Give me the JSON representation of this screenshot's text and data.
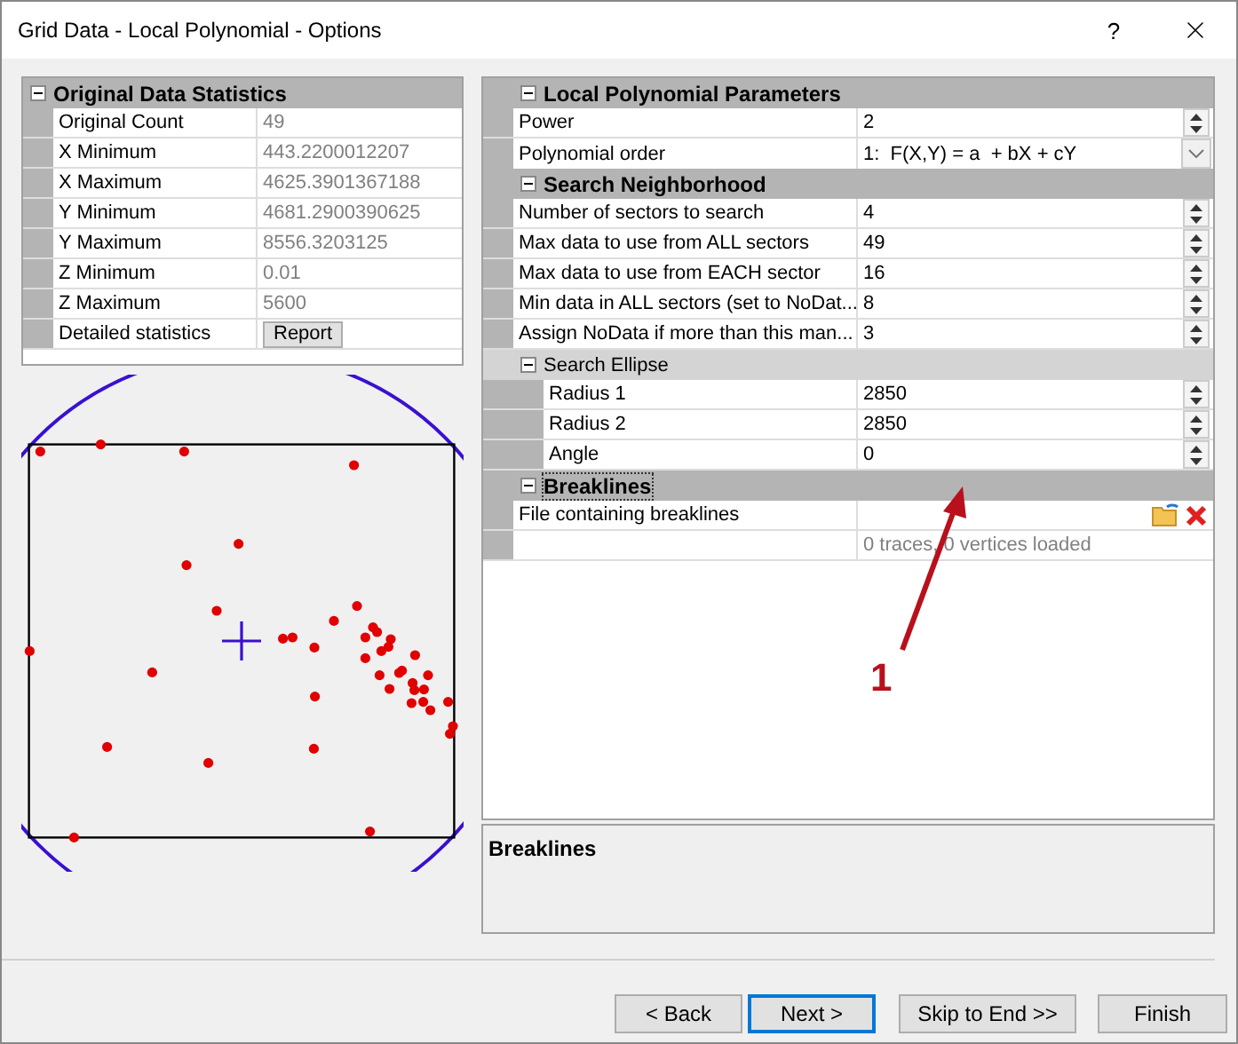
{
  "window": {
    "title": "Grid Data - Local Polynomial - Options",
    "help": "?"
  },
  "statistics": {
    "title": "Original Data Statistics",
    "expanded": true,
    "rows": [
      {
        "kind": "value",
        "label": "Original Count",
        "value": "49"
      },
      {
        "kind": "value",
        "label": "X Minimum",
        "value": "443.2200012207"
      },
      {
        "kind": "value",
        "label": "X Maximum",
        "value": "4625.3901367188"
      },
      {
        "kind": "value",
        "label": "Y Minimum",
        "value": "4681.2900390625"
      },
      {
        "kind": "value",
        "label": "Y Maximum",
        "value": "8556.3203125"
      },
      {
        "kind": "value",
        "label": "Z Minimum",
        "value": "0.01"
      },
      {
        "kind": "value",
        "label": "Z Maximum",
        "value": "5600"
      },
      {
        "kind": "button",
        "label": "Detailed statistics",
        "value": "Report"
      }
    ]
  },
  "properties": [
    {
      "kind": "category",
      "label": "Local Polynomial Parameters",
      "expanded": true,
      "focused": false,
      "children": [
        {
          "kind": "spin",
          "label": "Power",
          "value": "2"
        },
        {
          "kind": "dropdown",
          "label": "Polynomial order",
          "value": "1:  F(X,Y) = a  + bX + cY"
        }
      ]
    },
    {
      "kind": "category",
      "label": "Search Neighborhood",
      "expanded": true,
      "focused": false,
      "children": [
        {
          "kind": "spin",
          "label": "Number of sectors to search",
          "value": "4"
        },
        {
          "kind": "spin",
          "label": "Max data to use from ALL sectors",
          "value": "49"
        },
        {
          "kind": "spin",
          "label": "Max data to use from EACH sector",
          "value": "16"
        },
        {
          "kind": "spin",
          "label": "Min data in ALL sectors (set to NoDat...",
          "value": "8"
        },
        {
          "kind": "spin",
          "label": "Assign NoData if more than this man...",
          "value": "3"
        },
        {
          "kind": "subcategory",
          "label": "Search Ellipse",
          "expanded": true,
          "children": [
            {
              "kind": "spin",
              "label": "Radius 1",
              "value": "2850"
            },
            {
              "kind": "spin",
              "label": "Radius 2",
              "value": "2850"
            },
            {
              "kind": "spin",
              "label": "Angle",
              "value": "0"
            }
          ]
        }
      ]
    },
    {
      "kind": "category",
      "label": "Breaklines",
      "expanded": true,
      "focused": true,
      "children": [
        {
          "kind": "file",
          "label": "File containing breaklines"
        },
        {
          "kind": "info",
          "value": "0 traces, 0 vertices loaded"
        }
      ]
    }
  ],
  "description": {
    "title": "Breaklines"
  },
  "annotation": {
    "label": "1"
  },
  "buttons": [
    {
      "label": "< Back",
      "default": false
    },
    {
      "label": "Next >",
      "default": true
    },
    {
      "label": "Skip to End >>",
      "default": false
    },
    {
      "label": "Finish",
      "default": false
    }
  ]
}
